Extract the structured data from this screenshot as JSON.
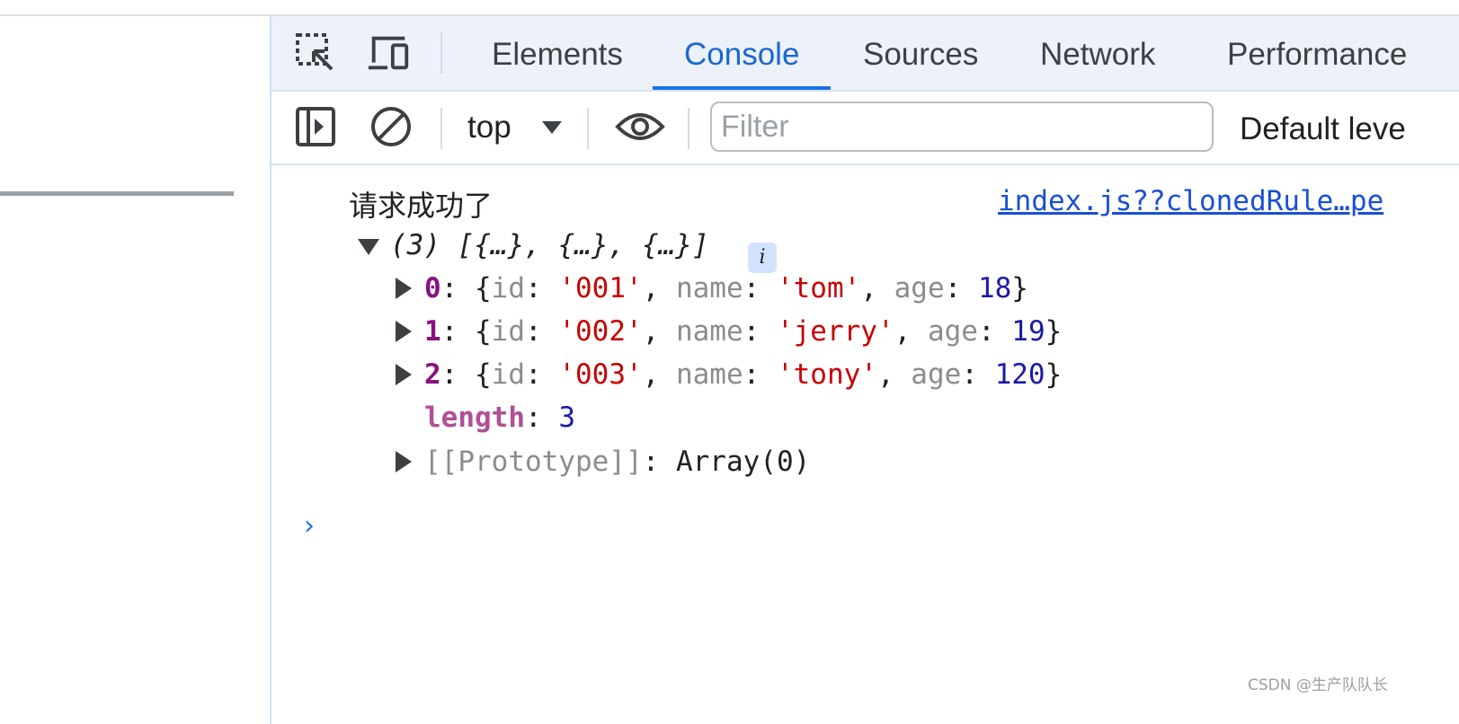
{
  "devtools": {
    "tabs": [
      {
        "label": "Elements",
        "active": false
      },
      {
        "label": "Console",
        "active": true
      },
      {
        "label": "Sources",
        "active": false
      },
      {
        "label": "Network",
        "active": false
      },
      {
        "label": "Performance",
        "active": false
      }
    ],
    "toolbar": {
      "context": "top",
      "filter_placeholder": "Filter",
      "levels_label": "Default leve"
    },
    "accent_color": "#1a73e8"
  },
  "console": {
    "message": "请求成功了",
    "source": "index.js??clonedRule…pe",
    "array_summary": "(3) [{…}, {…}, {…}]",
    "info_badge": "i",
    "items": [
      {
        "index": "0",
        "id": "'001'",
        "name": "'tom'",
        "age": "18"
      },
      {
        "index": "1",
        "id": "'002'",
        "name": "'jerry'",
        "age": "19"
      },
      {
        "index": "2",
        "id": "'003'",
        "name": "'tony'",
        "age": "120"
      }
    ],
    "length_key": "length",
    "length_value": "3",
    "prototype_key": "[[Prototype]]",
    "prototype_value": "Array(0)",
    "prompt": "›"
  },
  "watermark": "CSDN @生产队队长"
}
